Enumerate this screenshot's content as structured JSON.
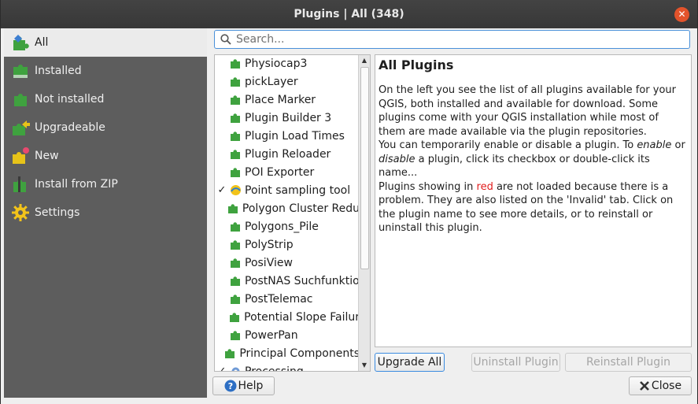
{
  "window": {
    "title": "Plugins | All (348)"
  },
  "sidebar": {
    "items": [
      {
        "label": "All",
        "icon": "puzzle-all-icon",
        "active": true
      },
      {
        "label": "Installed",
        "icon": "puzzle-installed-icon"
      },
      {
        "label": "Not installed",
        "icon": "puzzle-not-installed-icon"
      },
      {
        "label": "Upgradeable",
        "icon": "puzzle-upgradeable-icon"
      },
      {
        "label": "New",
        "icon": "puzzle-new-icon"
      },
      {
        "label": "Install from ZIP",
        "icon": "puzzle-zip-icon"
      },
      {
        "label": "Settings",
        "icon": "gear-icon"
      }
    ]
  },
  "search": {
    "placeholder": "Search..."
  },
  "plugins": [
    {
      "name": "Physiocap3",
      "checked": false
    },
    {
      "name": "pickLayer",
      "checked": false
    },
    {
      "name": "Place Marker",
      "checked": false
    },
    {
      "name": "Plugin Builder 3",
      "checked": false
    },
    {
      "name": "Plugin Load Times",
      "checked": false
    },
    {
      "name": "Plugin Reloader",
      "checked": false
    },
    {
      "name": "POI Exporter",
      "checked": false
    },
    {
      "name": "Point sampling tool",
      "checked": true
    },
    {
      "name": "Polygon Cluster Redu",
      "checked": false
    },
    {
      "name": "Polygons_Pile",
      "checked": false
    },
    {
      "name": "PolyStrip",
      "checked": false
    },
    {
      "name": "PosiView",
      "checked": false
    },
    {
      "name": "PostNAS Suchfunktio",
      "checked": false
    },
    {
      "name": "PostTelemac",
      "checked": false
    },
    {
      "name": "Potential Slope Failur",
      "checked": false
    },
    {
      "name": "PowerPan",
      "checked": false
    },
    {
      "name": "Principal Components",
      "checked": false
    },
    {
      "name": "Processing",
      "checked": true
    }
  ],
  "details": {
    "heading": "All Plugins",
    "p1": "On the left you see the list of all plugins available for your QGIS, both installed and available for download. Some plugins come with your QGIS installation while most of them are made available via the plugin repositories.",
    "p2a": "You can temporarily enable or disable a plugin. To ",
    "p2_enable": "enable",
    "p2b": " or ",
    "p2_disable": "disable",
    "p2c": " a plugin, click its checkbox or double-click its name...",
    "p3a": "Plugins showing in ",
    "p3_red": "red",
    "p3b": " are not loaded because there is a problem. They are also listed on the 'Invalid' tab. Click on the plugin name to see more details, or to reinstall or uninstall this plugin."
  },
  "buttons": {
    "upgrade_all": "Upgrade All",
    "uninstall": "Uninstall Plugin",
    "reinstall": "Reinstall Plugin",
    "help": "Help",
    "close": "Close"
  },
  "colors": {
    "accent": "#4a90d9",
    "sidebar": "#5d5d5d",
    "puzzle": "#3fa23f",
    "invalid_red": "#e11d1d"
  }
}
